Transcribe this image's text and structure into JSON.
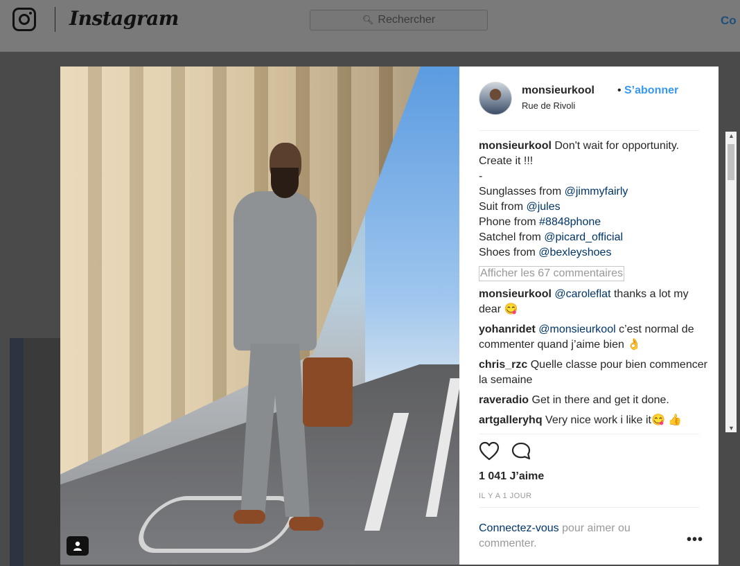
{
  "topbar": {
    "logo_text": "Instagram",
    "search_placeholder": "Rechercher",
    "connect_partial": "Co"
  },
  "post": {
    "author": {
      "username": "monsieurkool",
      "follow_label": "S’abonner",
      "location": "Rue de Rivoli"
    },
    "caption": {
      "username": "monsieurkool",
      "lines": [
        {
          "text": "Don't wait for opportunity. Create it !!!",
          "mention": ""
        },
        {
          "text": "-",
          "mention": ""
        },
        {
          "text": "Sunglasses from ",
          "mention": "@jimmyfairly"
        },
        {
          "text": "Suit from ",
          "mention": "@jules"
        },
        {
          "text": "Phone from ",
          "mention": "#8848phone"
        },
        {
          "text": "Satchel from ",
          "mention": "@picard_official"
        },
        {
          "text": "Shoes from ",
          "mention": "@bexleyshoes"
        }
      ]
    },
    "load_more_label": "Afficher les 67 commentaires",
    "comments": [
      {
        "user": "monsieurkool",
        "mention": "@caroleflat",
        "text": " thanks a lot my dear 😋"
      },
      {
        "user": "yohanridet",
        "mention": "@monsieurkool",
        "text": " c’est normal de commenter quand j’aime bien 👌"
      },
      {
        "user": "chris_rzc",
        "mention": "",
        "text": "Quelle classe pour bien commencer la semaine"
      },
      {
        "user": "raveradio",
        "mention": "",
        "text": "Get in there and get it done."
      },
      {
        "user": "artgalleryhq",
        "mention": "",
        "text": "Very nice work i like it😋 👍"
      }
    ],
    "likes_label": "1 041 J’aime",
    "timestamp": "IL Y A 1 JOUR",
    "login_link": "Connectez-vous",
    "login_rest": " pour aimer ou commenter.",
    "more_label": "•••"
  },
  "icons": {
    "heart": "heart-icon",
    "comment": "comment-bubble-icon",
    "tag": "user-tag-icon",
    "search": "search-icon",
    "camera": "instagram-camera-icon"
  },
  "colors": {
    "link_blue": "#3897f0",
    "mention_blue": "#003569",
    "muted": "#999999"
  }
}
